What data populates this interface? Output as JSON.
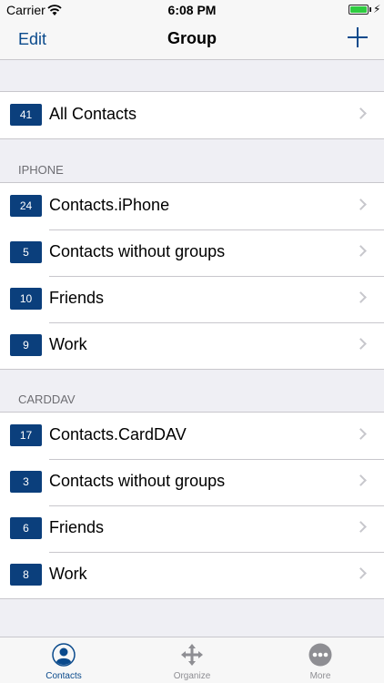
{
  "status_bar": {
    "carrier": "Carrier",
    "time": "6:08 PM"
  },
  "nav": {
    "edit_label": "Edit",
    "title": "Group",
    "add_icon": "plus-icon"
  },
  "all_contacts": {
    "count": "41",
    "label": "All Contacts"
  },
  "sections": [
    {
      "header": "IPHONE",
      "rows": [
        {
          "count": "24",
          "label": "Contacts.iPhone"
        },
        {
          "count": "5",
          "label": "Contacts without groups"
        },
        {
          "count": "10",
          "label": "Friends"
        },
        {
          "count": "9",
          "label": "Work"
        }
      ]
    },
    {
      "header": "CARDDAV",
      "rows": [
        {
          "count": "17",
          "label": "Contacts.CardDAV"
        },
        {
          "count": "3",
          "label": "Contacts without groups"
        },
        {
          "count": "6",
          "label": "Friends"
        },
        {
          "count": "8",
          "label": "Work"
        }
      ]
    }
  ],
  "tabs": [
    {
      "label": "Contacts",
      "icon": "person-icon",
      "active": true
    },
    {
      "label": "Organize",
      "icon": "move-arrows-icon",
      "active": false
    },
    {
      "label": "More",
      "icon": "ellipsis-icon",
      "active": false
    }
  ],
  "colors": {
    "accent": "#0a4a8c",
    "badge": "#0b3f7c",
    "background": "#efeff4"
  }
}
